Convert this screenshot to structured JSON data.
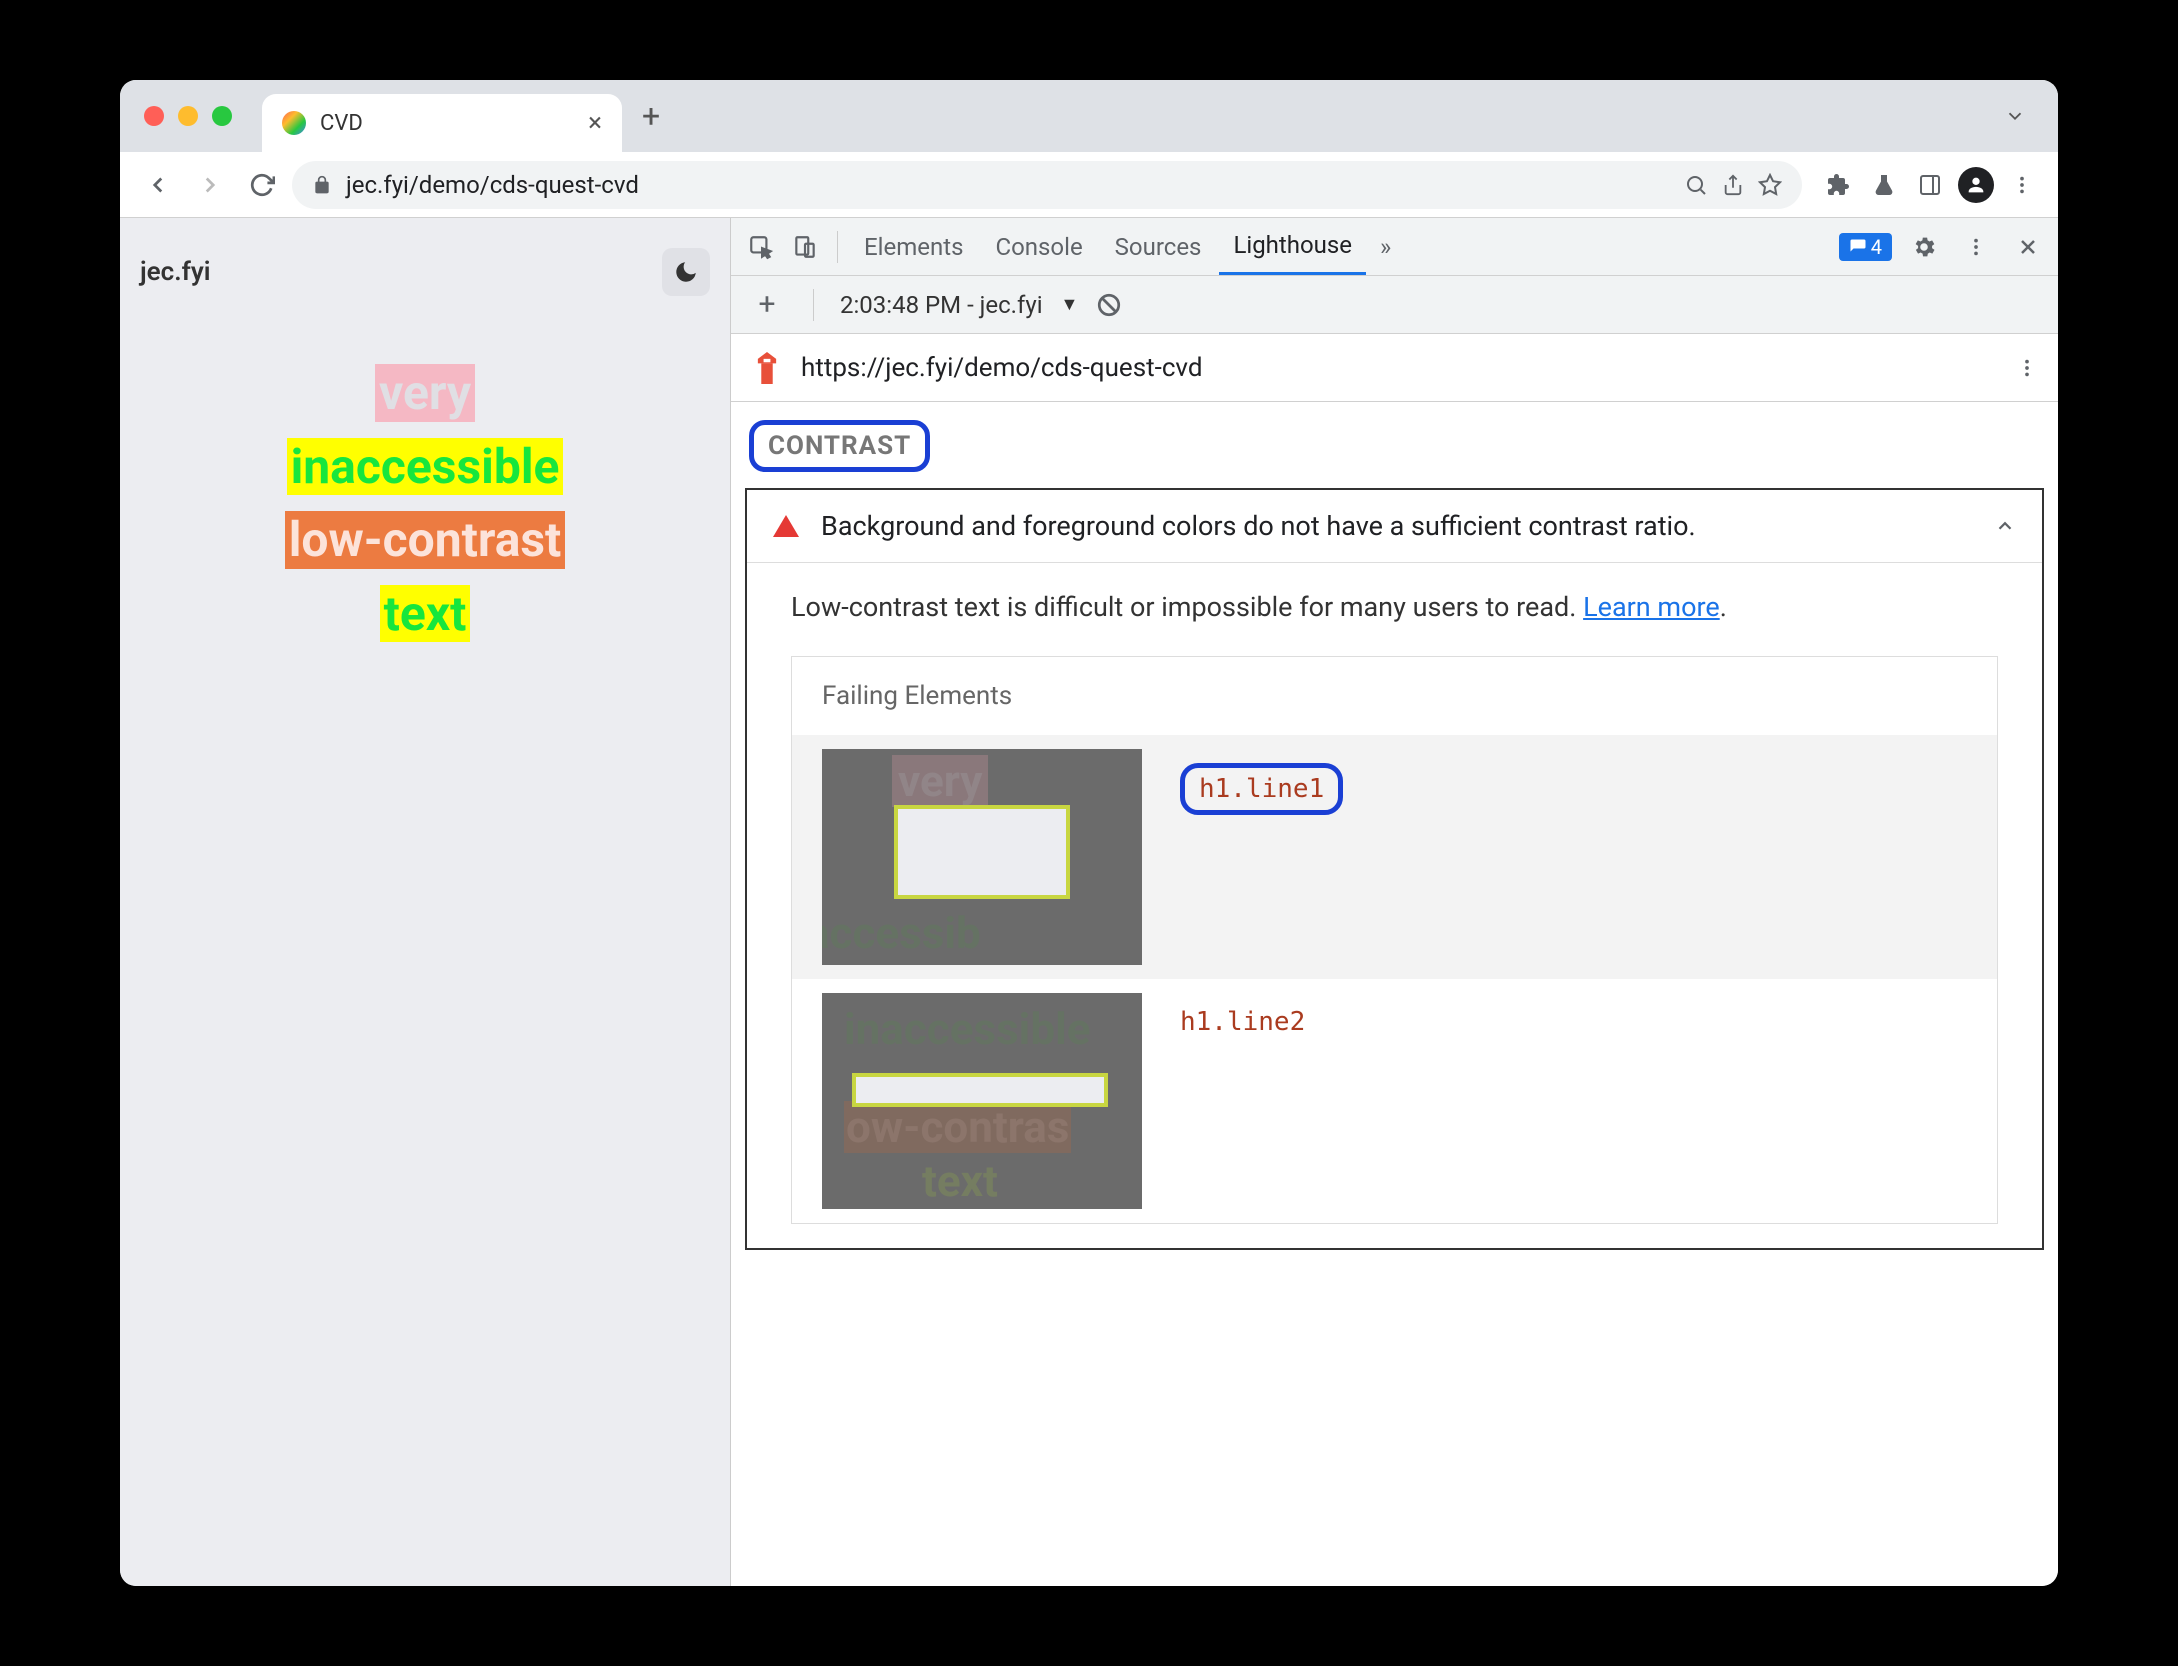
{
  "browser": {
    "tab_title": "CVD",
    "url_display": "jec.fyi/demo/cds-quest-cvd"
  },
  "page": {
    "site_title": "jec.fyi",
    "lines": {
      "l1": "very",
      "l2": "inaccessible",
      "l3": "low-contrast",
      "l4": "text"
    }
  },
  "devtools": {
    "tabs": {
      "elements": "Elements",
      "console": "Console",
      "sources": "Sources",
      "lighthouse": "Lighthouse"
    },
    "badge_count": "4",
    "subbar": {
      "timestamp": "2:03:48 PM - jec.fyi"
    },
    "lighthouse": {
      "url": "https://jec.fyi/demo/cds-quest-cvd",
      "category": "CONTRAST",
      "audit_title": "Background and foreground colors do not have a sufficient contrast ratio.",
      "audit_desc": "Low-contrast text is difficult or impossible for many users to read. ",
      "learn_more": "Learn more",
      "failing_title": "Failing Elements",
      "items": {
        "i1": "h1.line1",
        "i2": "h1.line2"
      }
    }
  }
}
